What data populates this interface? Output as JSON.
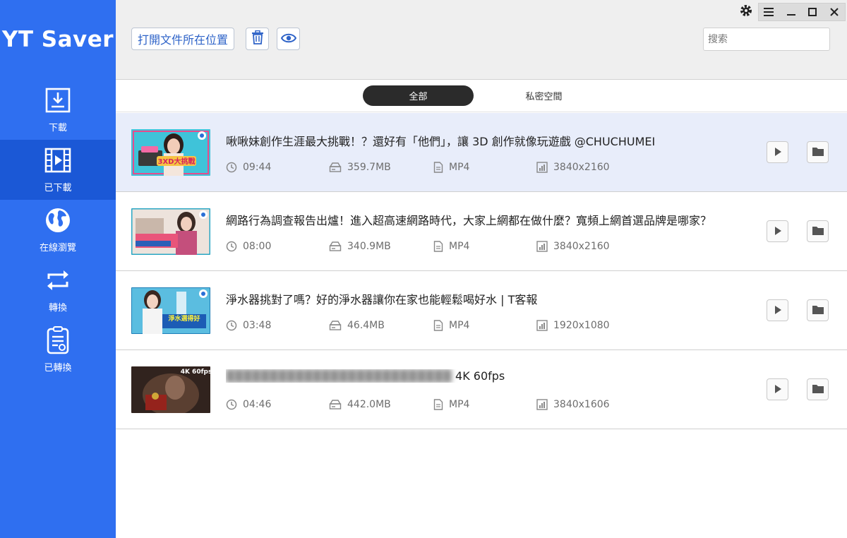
{
  "app": {
    "title": "YT Saver"
  },
  "sidebar": {
    "items": [
      {
        "label": "下載",
        "icon": "download-icon"
      },
      {
        "label": "已下載",
        "icon": "film-icon",
        "active": true
      },
      {
        "label": "在線瀏覽",
        "icon": "globe-icon"
      },
      {
        "label": "轉換",
        "icon": "convert-icon"
      },
      {
        "label": "已轉換",
        "icon": "converted-doc-icon"
      }
    ]
  },
  "toolbar": {
    "open_location_label": "打開文件所在位置",
    "delete_icon": "trash-icon",
    "view_icon": "eye-icon",
    "search_placeholder": "搜索"
  },
  "window_controls": [
    "gear-icon",
    "menu-icon",
    "minimize-icon",
    "maximize-icon",
    "close-icon"
  ],
  "tabs": [
    {
      "label": "全部",
      "active": true
    },
    {
      "label": "私密空間",
      "active": false
    }
  ],
  "videos": [
    {
      "title": "啾啾妹創作生涯最大挑戰！？還好有「他們」，讓 3D 創作就像玩遊戲 @CHUCHUMEI",
      "duration": "09:44",
      "size": "359.7MB",
      "format": "MP4",
      "resolution": "3840x2160",
      "thumb_caption": "3XD大挑戰"
    },
    {
      "title": "網路行為調查報告出爐！進入超高速網路時代，大家上網都在做什麼？寬頻上網首選品牌是哪家？",
      "duration": "08:00",
      "size": "340.9MB",
      "format": "MP4",
      "resolution": "3840x2160",
      "thumb_caption": ""
    },
    {
      "title": "淨水器挑對了嗎？好的淨水器讓你在家也能輕鬆喝好水 | T客報",
      "duration": "03:48",
      "size": "46.4MB",
      "format": "MP4",
      "resolution": "1920x1080",
      "thumb_caption": "淨水選得好"
    },
    {
      "title_visible": "4K 60fps",
      "duration": "04:46",
      "size": "442.0MB",
      "format": "MP4",
      "resolution": "3840x1606",
      "thumb_caption": "4K 60fps"
    }
  ],
  "colors": {
    "sidebar": "#2f6ff0",
    "sidebar_active": "#1b58d6",
    "selected_row": "#e8edfa",
    "accent": "#2e63c8"
  }
}
